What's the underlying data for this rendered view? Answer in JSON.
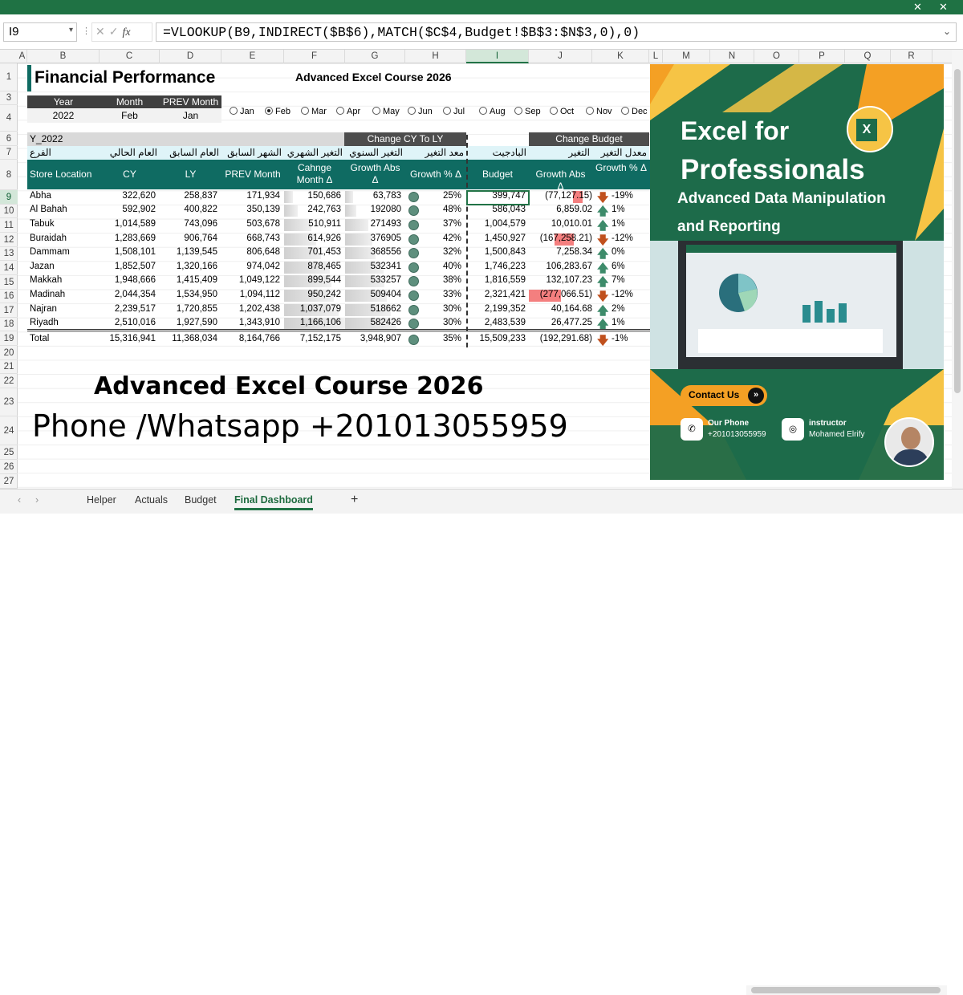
{
  "name_box": "I9",
  "formula": "=VLOOKUP(B9,INDIRECT($B$6),MATCH($C$4,Budget!$B$3:$N$3,0),0)",
  "columns": [
    "A",
    "B",
    "C",
    "D",
    "E",
    "F",
    "G",
    "H",
    "I",
    "J",
    "K",
    "L",
    "M",
    "N",
    "O",
    "P",
    "Q",
    "R"
  ],
  "rows": [
    "1",
    "3",
    "4",
    "6",
    "7",
    "8",
    "9",
    "10",
    "11",
    "12",
    "13",
    "14",
    "15",
    "16",
    "17",
    "18",
    "19",
    "20",
    "21",
    "22",
    "23",
    "24",
    "25",
    "26",
    "27"
  ],
  "header": {
    "title": "Financial Performance",
    "course": "Advanced Excel Course 2026"
  },
  "params": {
    "labels": [
      "Year",
      "Month",
      "PREV Month"
    ],
    "values": [
      "2022",
      "Feb",
      "Jan"
    ]
  },
  "months": [
    "Jan",
    "Feb",
    "Mar",
    "Apr",
    "May",
    "Jun",
    "Jul",
    "Aug",
    "Sep",
    "Oct",
    "Nov",
    "Dec"
  ],
  "selected_month": "Feb",
  "sections": {
    "y": "Y_2022",
    "change_cy_ly": "Change CY To LY",
    "change_budget": "Change Budget"
  },
  "arabic": [
    "الفرع",
    "العام الحالي",
    "العام السابق",
    "الشهر السابق",
    "التغير الشهري",
    "التغير السنوي",
    "معد التغير",
    "البادجيت",
    "التغير",
    "معدل التغير"
  ],
  "table_headers": [
    "Store Location",
    "CY",
    "LY",
    "PREV Month",
    "Cahnge Month Δ",
    "Growth Abs Δ",
    "Growth % Δ",
    "Budget",
    "Growth Abs Δ",
    "Growth % Δ"
  ],
  "table_rows": [
    {
      "loc": "Abha",
      "cy": "322,620",
      "ly": "258,837",
      "prev": "171,934",
      "mchg": "150,686",
      "gabs": "63,783",
      "gpct": "25%",
      "budget": "399,747",
      "babs": "(77,127.15)",
      "bpct": "-19%",
      "dir": "down",
      "bar": 0.15,
      "neg": 0.3
    },
    {
      "loc": "Al Bahah",
      "cy": "592,902",
      "ly": "400,822",
      "prev": "350,139",
      "mchg": "242,763",
      "gabs": "192080",
      "gpct": "48%",
      "budget": "586,043",
      "babs": "6,859.02",
      "bpct": "1%",
      "dir": "up",
      "bar": 0.22,
      "neg": 0
    },
    {
      "loc": "Tabuk",
      "cy": "1,014,589",
      "ly": "743,096",
      "prev": "503,678",
      "mchg": "510,911",
      "gabs": "271493",
      "gpct": "37%",
      "budget": "1,004,579",
      "babs": "10,010.01",
      "bpct": "1%",
      "dir": "up",
      "bar": 0.45,
      "neg": 0
    },
    {
      "loc": "Buraidah",
      "cy": "1,283,669",
      "ly": "906,764",
      "prev": "668,743",
      "mchg": "614,926",
      "gabs": "376905",
      "gpct": "42%",
      "budget": "1,450,927",
      "babs": "(167,258.21)",
      "bpct": "-12%",
      "dir": "down",
      "bar": 0.53,
      "neg": 0.6
    },
    {
      "loc": "Dammam",
      "cy": "1,508,101",
      "ly": "1,139,545",
      "prev": "806,648",
      "mchg": "701,453",
      "gabs": "368556",
      "gpct": "32%",
      "budget": "1,500,843",
      "babs": "7,258.34",
      "bpct": "0%",
      "dir": "up",
      "bar": 0.6,
      "neg": 0
    },
    {
      "loc": "Jazan",
      "cy": "1,852,507",
      "ly": "1,320,166",
      "prev": "974,042",
      "mchg": "878,465",
      "gabs": "532341",
      "gpct": "40%",
      "budget": "1,746,223",
      "babs": "106,283.67",
      "bpct": "6%",
      "dir": "up",
      "bar": 0.75,
      "neg": 0
    },
    {
      "loc": "Makkah",
      "cy": "1,948,666",
      "ly": "1,415,409",
      "prev": "1,049,122",
      "mchg": "899,544",
      "gabs": "533257",
      "gpct": "38%",
      "budget": "1,816,559",
      "babs": "132,107.23",
      "bpct": "7%",
      "dir": "up",
      "bar": 0.77,
      "neg": 0
    },
    {
      "loc": "Madinah",
      "cy": "2,044,354",
      "ly": "1,534,950",
      "prev": "1,094,112",
      "mchg": "950,242",
      "gabs": "509404",
      "gpct": "33%",
      "budget": "2,321,421",
      "babs": "(277,066.51)",
      "bpct": "-12%",
      "dir": "down",
      "bar": 0.82,
      "neg": 1
    },
    {
      "loc": "Najran",
      "cy": "2,239,517",
      "ly": "1,720,855",
      "prev": "1,202,438",
      "mchg": "1,037,079",
      "gabs": "518662",
      "gpct": "30%",
      "budget": "2,199,352",
      "babs": "40,164.68",
      "bpct": "2%",
      "dir": "up",
      "bar": 0.9,
      "neg": 0
    },
    {
      "loc": "Riyadh",
      "cy": "2,510,016",
      "ly": "1,927,590",
      "prev": "1,343,910",
      "mchg": "1,166,106",
      "gabs": "582426",
      "gpct": "30%",
      "budget": "2,483,539",
      "babs": "26,477.25",
      "bpct": "1%",
      "dir": "up",
      "bar": 1,
      "neg": 0
    }
  ],
  "total": {
    "loc": "Total",
    "cy": "15,316,941",
    "ly": "11,368,034",
    "prev": "8,164,766",
    "mchg": "7,152,175",
    "gabs": "3,948,907",
    "gpct": "35%",
    "budget": "15,509,233",
    "babs": "(192,291.68)",
    "bpct": "-1%",
    "dir": "down"
  },
  "ad": {
    "line1": "Advanced Excel Course 2026",
    "line2": "Phone /Whatsapp +201013055959"
  },
  "banner": {
    "title1": "Excel for",
    "title2": "Professionals",
    "sub1": "Advanced Data Manipulation",
    "sub2": "and Reporting",
    "contact": "Contact Us",
    "phone_label": "Our Phone",
    "phone": "+201013055959",
    "instr_label": "instructor",
    "instr": "Mohamed Elrify",
    "colors": {
      "green": "#1d6b4a",
      "orange": "#f4a024"
    }
  },
  "sheets": [
    "Helper",
    "Actuals",
    "Budget",
    "Final Dashboard"
  ],
  "active_sheet": "Final Dashboard"
}
